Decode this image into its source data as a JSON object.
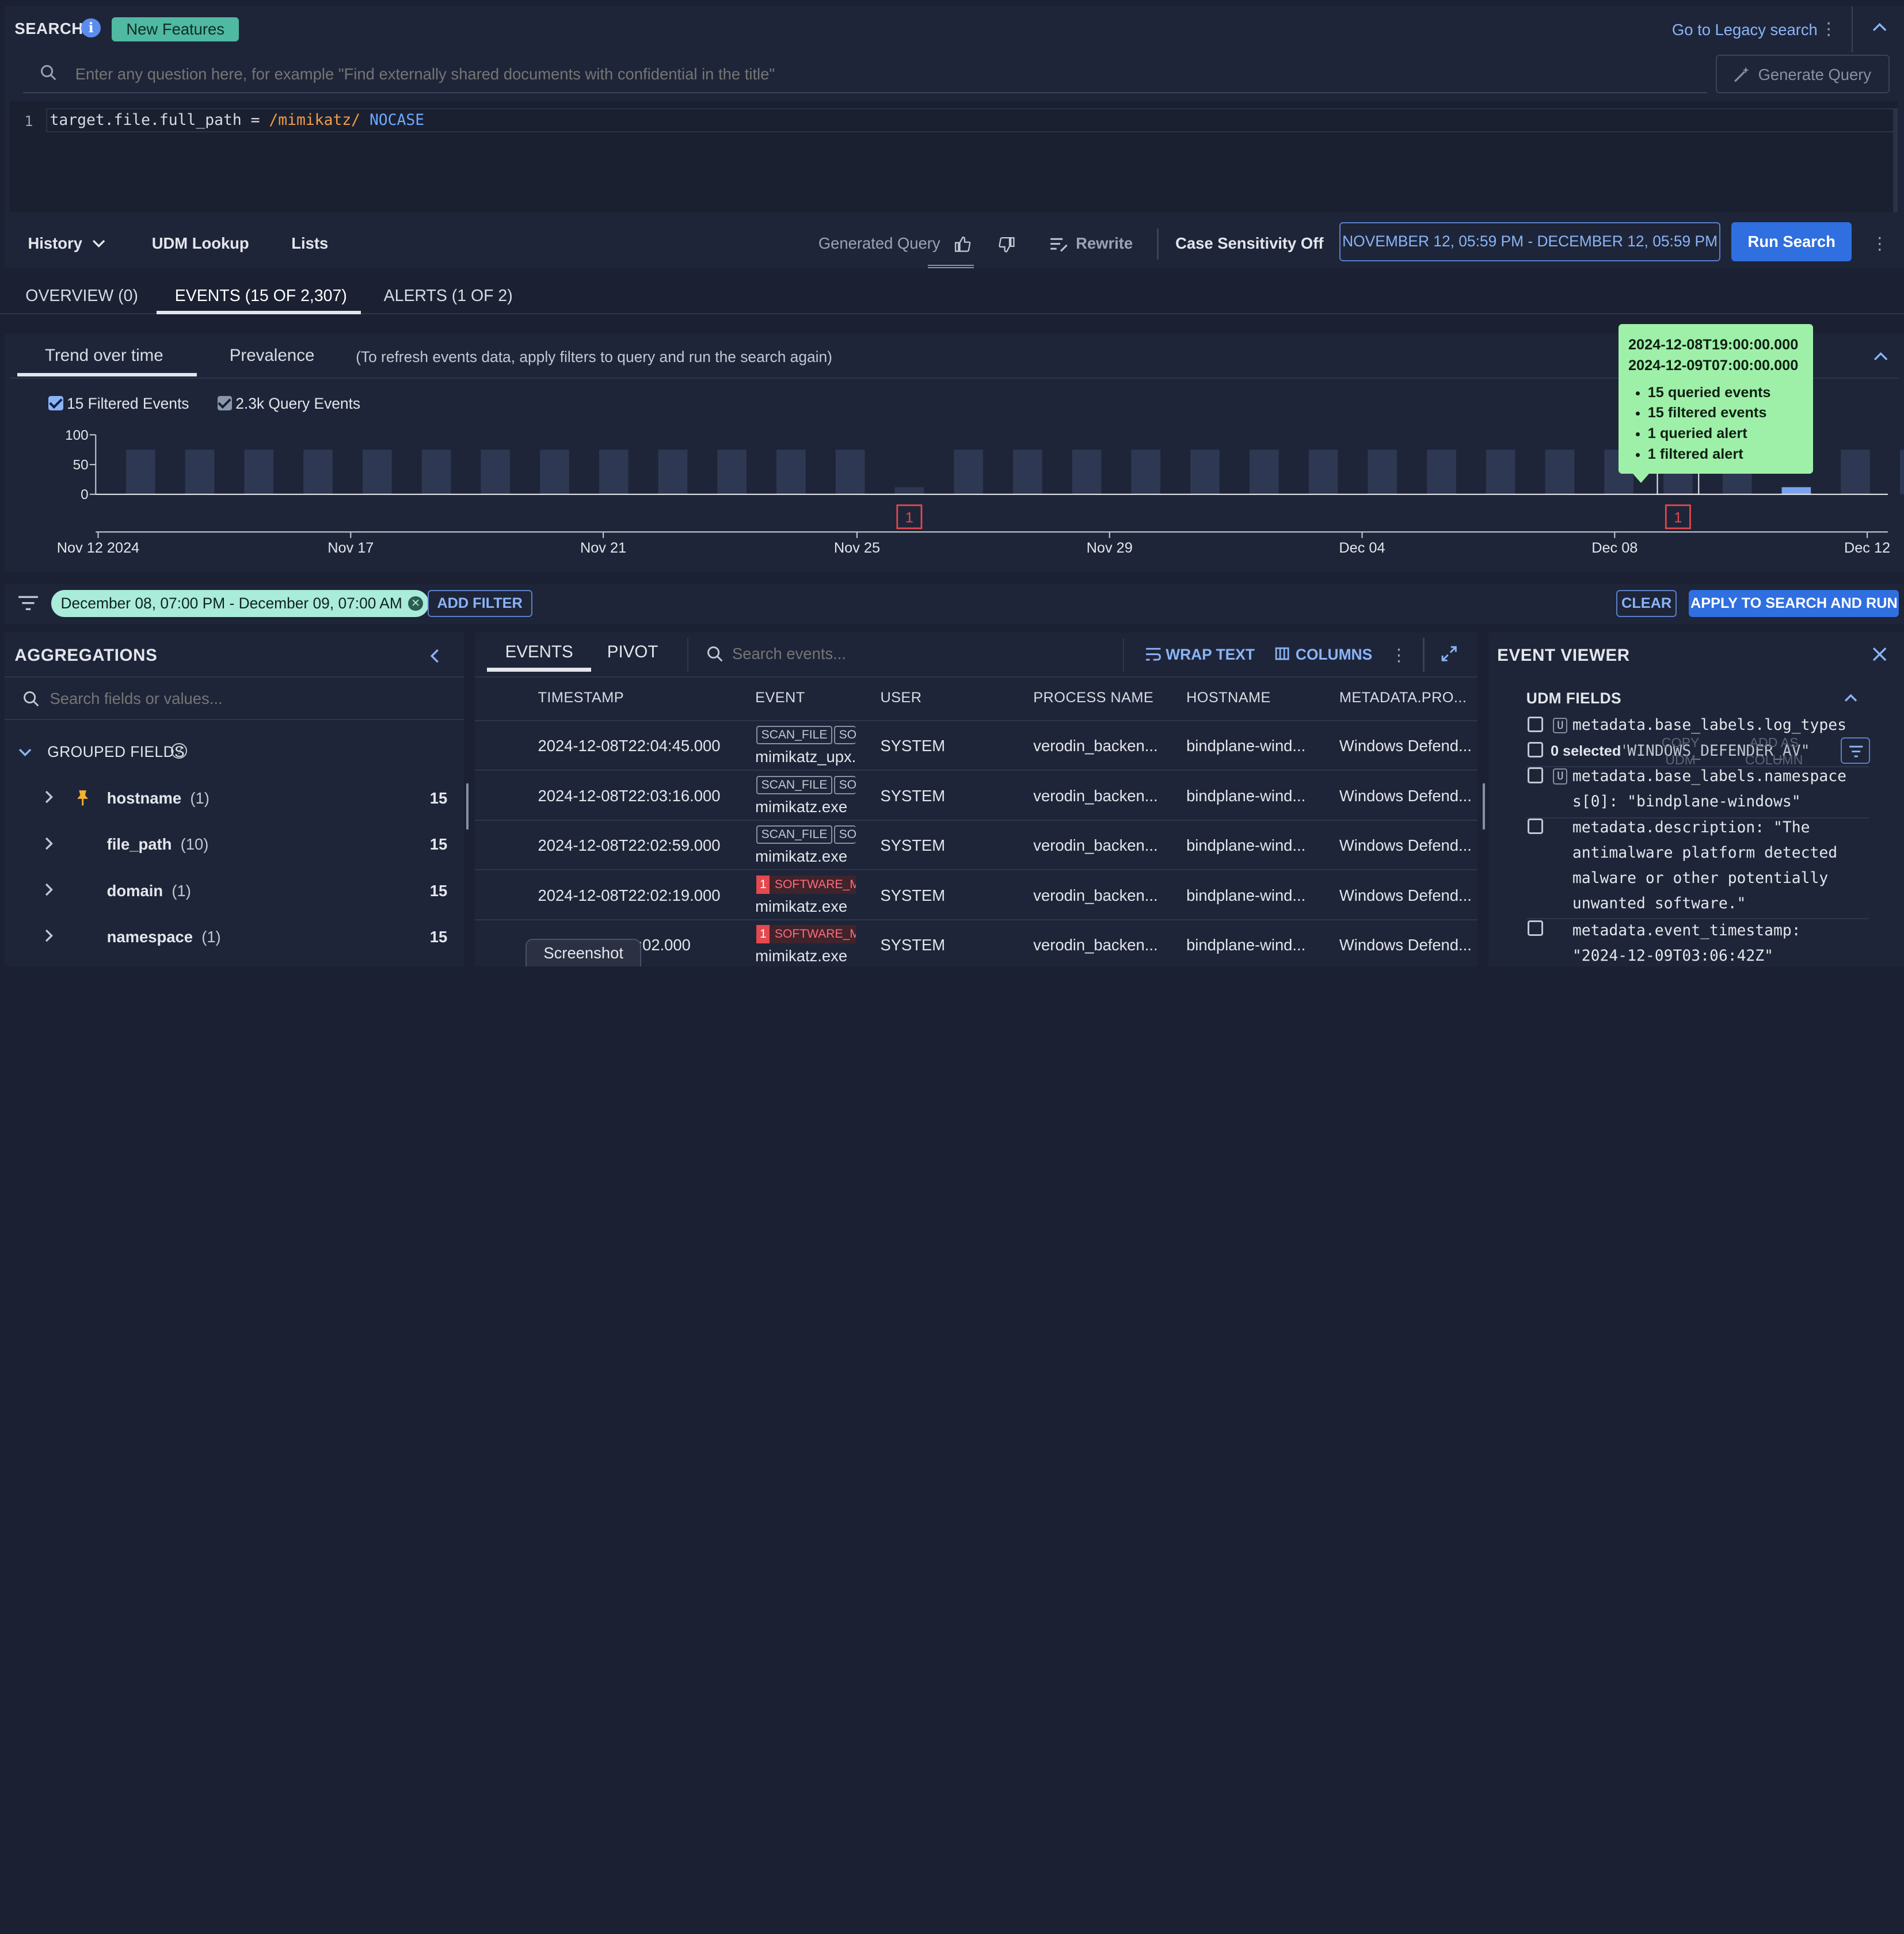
{
  "search": {
    "label": "SEARCH",
    "new_features_badge": "New Features",
    "legacy_link": "Go to Legacy search",
    "nl_placeholder": "Enter any question here, for example \"Find externally shared documents with confidential in the title\"",
    "generate_query_label": "Generate Query",
    "editor": {
      "line_number": "1",
      "tokens": {
        "field": "target.file.full_path",
        "op": " = ",
        "regex": "/mimikatz/",
        "modifier": "NOCASE"
      }
    }
  },
  "toolbar": {
    "history_label": "History",
    "udm_lookup_label": "UDM Lookup",
    "lists_label": "Lists",
    "generated_query_label": "Generated Query",
    "rewrite_label": "Rewrite",
    "case_sensitivity_label": "Case Sensitivity Off",
    "date_range_label": "NOVEMBER 12, 05:59 PM - DECEMBER 12, 05:59 PM",
    "run_search_label": "Run Search"
  },
  "main_tabs": [
    {
      "label": "OVERVIEW (0)"
    },
    {
      "label": "EVENTS (15 OF 2,307)"
    },
    {
      "label": "ALERTS (1 OF 2)"
    }
  ],
  "trend": {
    "tabs": [
      "Trend over time",
      "Prevalence"
    ],
    "hint": "(To refresh events data, apply filters to query and run the search again)",
    "legend": {
      "filtered_label": "15 Filtered Events",
      "query_label": "2.3k Query Events"
    },
    "tooltip": {
      "start": "2024-12-08T19:00:00.000",
      "end": "2024-12-09T07:00:00.000",
      "items": [
        "15 queried events",
        "15 filtered events",
        "1 queried alert",
        "1 filtered alert"
      ]
    },
    "colors": {
      "query_bar": "#2e3852",
      "filtered_bar": "#7ba2ee",
      "alert": "#e5484d",
      "tooltip": "#9ef0a9"
    }
  },
  "chart_data": {
    "type": "bar",
    "y_ticks": [
      "100",
      "50",
      "0"
    ],
    "ylim": [
      0,
      100
    ],
    "x_tick_labels": [
      "Nov 12 2024",
      "Nov 17",
      "Nov 21",
      "Nov 25",
      "Nov 29",
      "Dec 04",
      "Dec 08",
      "Dec 12"
    ],
    "series": [
      {
        "name": "2.3k Query Events",
        "values": [
          75,
          75,
          75,
          75,
          75,
          75,
          75,
          75,
          75,
          75,
          75,
          75,
          75,
          12,
          75,
          75,
          75,
          75,
          75,
          75,
          75,
          75,
          75,
          75,
          75,
          75,
          75,
          75,
          12,
          75,
          75,
          75,
          75,
          75,
          75,
          75,
          75,
          75,
          75
        ]
      },
      {
        "name": "15 Filtered Events",
        "values": [
          0,
          0,
          0,
          0,
          0,
          0,
          0,
          0,
          0,
          0,
          0,
          0,
          0,
          0,
          0,
          0,
          0,
          0,
          0,
          0,
          0,
          0,
          0,
          0,
          0,
          0,
          0,
          0,
          12,
          0,
          0,
          0,
          0,
          0,
          0,
          0,
          0,
          0,
          0
        ]
      }
    ],
    "alert_markers": [
      {
        "bar_index": 13,
        "label": "1"
      },
      {
        "bar_index": 26,
        "label": "1"
      }
    ]
  },
  "filter_bar": {
    "chip_label": "December 08, 07:00 PM - December 09, 07:00 AM",
    "add_filter_label": "ADD FILTER",
    "clear_label": "CLEAR",
    "apply_label": "APPLY TO SEARCH AND RUN"
  },
  "aggregations": {
    "title": "AGGREGATIONS",
    "search_placeholder": "Search fields or values...",
    "grouped_label": "GROUPED FIELDS",
    "rows": [
      {
        "name": "hostname",
        "distinct": "(1)",
        "count": "15",
        "pinned": true
      },
      {
        "name": "file_path",
        "distinct": "(10)",
        "count": "15",
        "pinned": false
      },
      {
        "name": "domain",
        "distinct": "(1)",
        "count": "15",
        "pinned": false
      },
      {
        "name": "namespace",
        "distinct": "(1)",
        "count": "15",
        "pinned": false
      }
    ]
  },
  "events": {
    "tabs": [
      "EVENTS",
      "PIVOT"
    ],
    "search_placeholder": "Search events...",
    "wrap_text_label": "WRAP TEXT",
    "columns_label": "COLUMNS",
    "columns": [
      "TIMESTAMP",
      "EVENT",
      "USER",
      "PROCESS NAME",
      "HOSTNAME",
      "METADATA.PRO..."
    ],
    "rows": [
      {
        "timestamp": "2024-12-08T22:04:45.000",
        "tag1": "SCAN_FILE",
        "tag2": "SO",
        "alert": "",
        "file": "mimikatz_upx.",
        "user": "SYSTEM",
        "process": "verodin_backen...",
        "hostname": "bindplane-wind...",
        "meta": "Windows Defend..."
      },
      {
        "timestamp": "2024-12-08T22:03:16.000",
        "tag1": "SCAN_FILE",
        "tag2": "SO",
        "alert": "",
        "file": "mimikatz.exe",
        "user": "SYSTEM",
        "process": "verodin_backen...",
        "hostname": "bindplane-wind...",
        "meta": "Windows Defend..."
      },
      {
        "timestamp": "2024-12-08T22:02:59.000",
        "tag1": "SCAN_FILE",
        "tag2": "SO",
        "alert": "",
        "file": "mimikatz.exe",
        "user": "SYSTEM",
        "process": "verodin_backen...",
        "hostname": "bindplane-wind...",
        "meta": "Windows Defend..."
      },
      {
        "timestamp": "2024-12-08T22:02:19.000",
        "tag1": "SOFTWARE_M",
        "tag2": "",
        "alert": "1",
        "file": "mimikatz.exe",
        "user": "SYSTEM",
        "process": "verodin_backen...",
        "hostname": "bindplane-wind...",
        "meta": "Windows Defend..."
      },
      {
        "timestamp": "2024-12-08T22:02:02.000",
        "tag1": "SOFTWARE_M",
        "tag2": "",
        "alert": "1",
        "file": "mimikatz.exe",
        "user": "SYSTEM",
        "process": "verodin_backen...",
        "hostname": "bindplane-wind...",
        "meta": "Windows Defend..."
      }
    ],
    "screenshot_label": "Screenshot"
  },
  "viewer": {
    "title": "EVENT VIEWER",
    "section_label": "UDM FIELDS",
    "selected_label": "0 selected",
    "copy_udm_label": "COPY UDM",
    "add_column_label": "ADD AS COLUMN",
    "u_icon": "U",
    "fields": [
      {
        "key": "metadata.base_labels.log_types",
        "line2": "[0]: \"WINDOWS_DEFENDER_AV\"",
        "line3": "",
        "line4": ""
      },
      {
        "key": "metadata.base_labels.namespace",
        "line2": "s[0]: \"bindplane-windows\"",
        "line3": "",
        "line4": ""
      },
      {
        "key": "metadata.description: \"The",
        "line2": "antimalware platform detected",
        "line3": "malware or other potentially",
        "line4": "unwanted software.\""
      },
      {
        "key": "metadata.event_timestamp:",
        "line2": "\"2024-12-09T03:06:42Z\"",
        "line3": "",
        "line4": ""
      }
    ]
  }
}
